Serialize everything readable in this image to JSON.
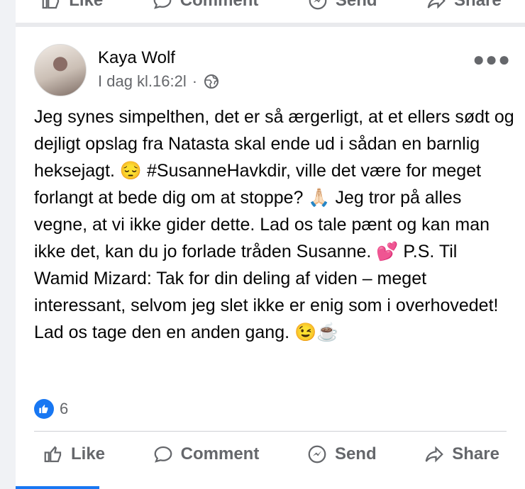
{
  "top_actions": {
    "like": "Like",
    "comment": "Comment",
    "send": "Send",
    "share": "Share"
  },
  "post": {
    "author": "Kaya Wolf",
    "timestamp": "I dag kl.16:2l",
    "separator": "·",
    "text": "Jeg synes simpelthen, det er så ærgerligt, at et ellers sødt og dejligt opslag fra Natasta skal ende ud i sådan en barnlig heksejagt. 😔 #SusanneHavkdir, ville det være for meget forlangt at bede dig om at stoppe? 🙏🏻 Jeg tror på alles vegne, at vi ikke gider dette. Lad os tale pænt og kan man ikke det, kan du jo forlade tråden Susanne. 💕 P.S. Til Wamid Mizard: Tak for din deling af viden – meget interessant, selvom jeg slet ikke er enig som i overhovedet! Lad os tage den en anden gang. 😉☕",
    "reaction_count": "6"
  },
  "actions": {
    "like": "Like",
    "comment": "Comment",
    "send": "Send",
    "share": "Share"
  },
  "icons": {
    "privacy": "globe-icon",
    "reaction": "thumbs-up-icon",
    "menu": "more-dots-icon"
  },
  "colors": {
    "accent": "#1877f2",
    "secondary_text": "#65676b"
  }
}
